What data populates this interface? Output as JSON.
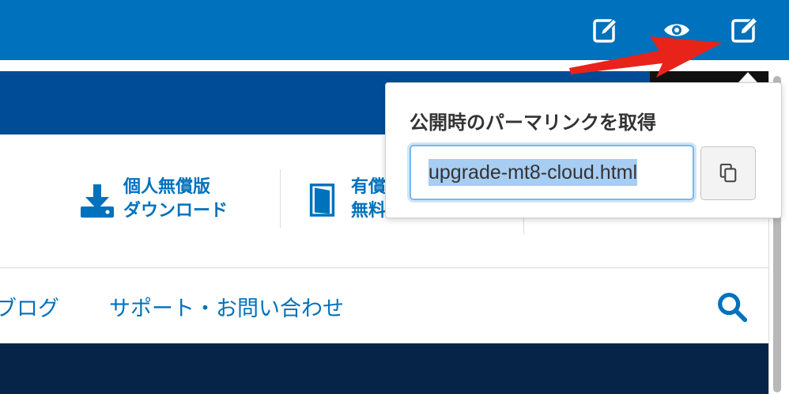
{
  "toolbar": {
    "edit_icon": "edit-note-icon",
    "preview_icon": "eye-icon",
    "permalink_icon": "external-edit-icon"
  },
  "header_links": {
    "download": {
      "line1": "個人無償版",
      "line2": "ダウンロード",
      "icon": "download-icon"
    },
    "trial": {
      "line1": "有償",
      "line2": "無料",
      "icon": "door-icon"
    }
  },
  "nav": {
    "blog": "ブログ",
    "support": "サポート・お問い合わせ",
    "search_icon": "search-icon"
  },
  "popover": {
    "title": "公開時のパーマリンクを取得",
    "url_value": "upgrade-mt8-cloud.html",
    "copy_icon": "copy-icon"
  },
  "colors": {
    "toolbar": "#0071bc",
    "header_band": "#004c97",
    "bottom_band": "#062448",
    "link": "#0071bc",
    "annotation": "#e8231a"
  }
}
